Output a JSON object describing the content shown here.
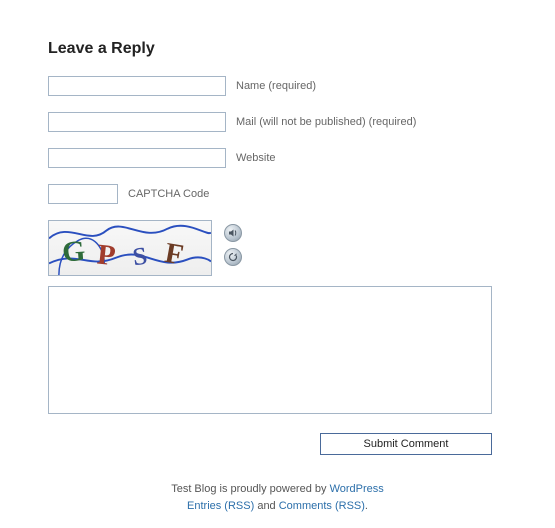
{
  "heading": "Leave a Reply",
  "fields": {
    "name": {
      "label": "Name (required)",
      "value": ""
    },
    "mail": {
      "label": "Mail (will not be published) (required)",
      "value": ""
    },
    "website": {
      "label": "Website",
      "value": ""
    },
    "captcha": {
      "label": "CAPTCHA Code",
      "value": ""
    }
  },
  "captcha_image_text": "GPSF",
  "comment": {
    "value": ""
  },
  "submit_label": "Submit Comment",
  "footer": {
    "line1_prefix": "Test Blog is proudly powered by ",
    "wordpress": "WordPress",
    "entries_rss": "Entries (RSS)",
    "and": " and ",
    "comments_rss": "Comments (RSS)",
    "period": "."
  }
}
